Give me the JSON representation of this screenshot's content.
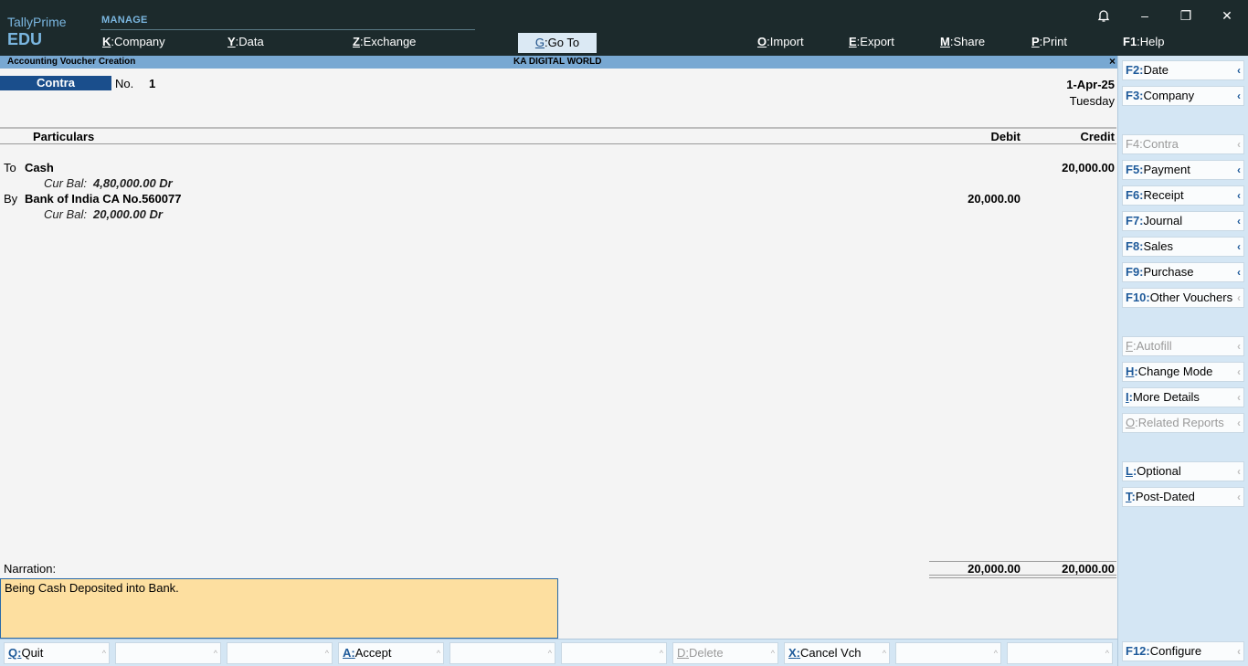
{
  "app": {
    "brand": "TallyPrime",
    "edition": "EDU",
    "manage_label": "MANAGE"
  },
  "top_menu": [
    {
      "key": "K",
      "label": "Company"
    },
    {
      "key": "Y",
      "label": "Data"
    },
    {
      "key": "Z",
      "label": "Exchange"
    },
    {
      "key": "G",
      "label": "Go To"
    },
    {
      "key": "O",
      "label": "Import"
    },
    {
      "key": "E",
      "label": "Export"
    },
    {
      "key": "M",
      "label": "Share"
    },
    {
      "key": "P",
      "label": "Print"
    },
    {
      "key": "F1",
      "label": "Help"
    }
  ],
  "window_controls": {
    "bell": "bell-icon",
    "minimize": "–",
    "maximize": "❐",
    "close": "✕"
  },
  "title_strip": {
    "screen": "Accounting Voucher Creation",
    "company": "KA DIGITAL WORLD",
    "close": "×"
  },
  "voucher": {
    "type": "Contra",
    "no_label": "No.",
    "no_value": "1",
    "date": "1-Apr-25",
    "day": "Tuesday"
  },
  "columns": {
    "particulars": "Particulars",
    "debit": "Debit",
    "credit": "Credit"
  },
  "entries": [
    {
      "side": "To",
      "ledger": "Cash",
      "bal_label": "Cur Bal:",
      "bal_value": "4,80,000.00 Dr",
      "debit": "",
      "credit": "20,000.00"
    },
    {
      "side": "By",
      "ledger": "Bank of India CA No.560077",
      "bal_label": "Cur Bal:",
      "bal_value": "20,000.00 Dr",
      "debit": "20,000.00",
      "credit": ""
    }
  ],
  "narration": {
    "label": "Narration:",
    "text": "Being Cash Deposited into Bank."
  },
  "totals": {
    "debit": "20,000.00",
    "credit": "20,000.00"
  },
  "right_panel": [
    {
      "key": "F2",
      "label": "Date",
      "enabled": true
    },
    {
      "key": "F3",
      "label": "Company",
      "enabled": true
    },
    {
      "key": "F4",
      "label": "Contra",
      "enabled": false
    },
    {
      "key": "F5",
      "label": "Payment",
      "enabled": true
    },
    {
      "key": "F6",
      "label": "Receipt",
      "enabled": true
    },
    {
      "key": "F7",
      "label": "Journal",
      "enabled": true
    },
    {
      "key": "F8",
      "label": "Sales",
      "enabled": true
    },
    {
      "key": "F9",
      "label": "Purchase",
      "enabled": true
    },
    {
      "key": "F10",
      "label": "Other Vouchers",
      "enabled": true
    },
    {
      "key": "F",
      "label": "Autofill",
      "enabled": false
    },
    {
      "key": "H",
      "label": "Change Mode",
      "enabled": true
    },
    {
      "key": "I",
      "label": "More Details",
      "enabled": true
    },
    {
      "key": "O",
      "label": "Related Reports",
      "enabled": false
    },
    {
      "key": "L",
      "label": "Optional",
      "enabled": true
    },
    {
      "key": "T",
      "label": "Post-Dated",
      "enabled": true
    }
  ],
  "bottom_bar": [
    {
      "key": "Q",
      "label": "Quit",
      "enabled": true
    },
    {
      "key": "",
      "label": "",
      "enabled": true
    },
    {
      "key": "",
      "label": "",
      "enabled": true
    },
    {
      "key": "A",
      "label": "Accept",
      "enabled": true
    },
    {
      "key": "",
      "label": "",
      "enabled": true
    },
    {
      "key": "",
      "label": "",
      "enabled": true
    },
    {
      "key": "D",
      "label": "Delete",
      "enabled": false
    },
    {
      "key": "X",
      "label": "Cancel Vch",
      "enabled": true
    },
    {
      "key": "",
      "label": "",
      "enabled": true
    },
    {
      "key": "",
      "label": "",
      "enabled": true
    },
    {
      "key": "F12",
      "label": "Configure",
      "enabled": true
    }
  ],
  "colors": {
    "topbar_bg": "#1c2a2c",
    "brand": "#7ab6e0",
    "title_strip": "#78a8d2",
    "voucher_type_bg": "#1a4e8c",
    "panel_bg": "#d4e6f4",
    "narration_bg": "#fddfa0"
  }
}
